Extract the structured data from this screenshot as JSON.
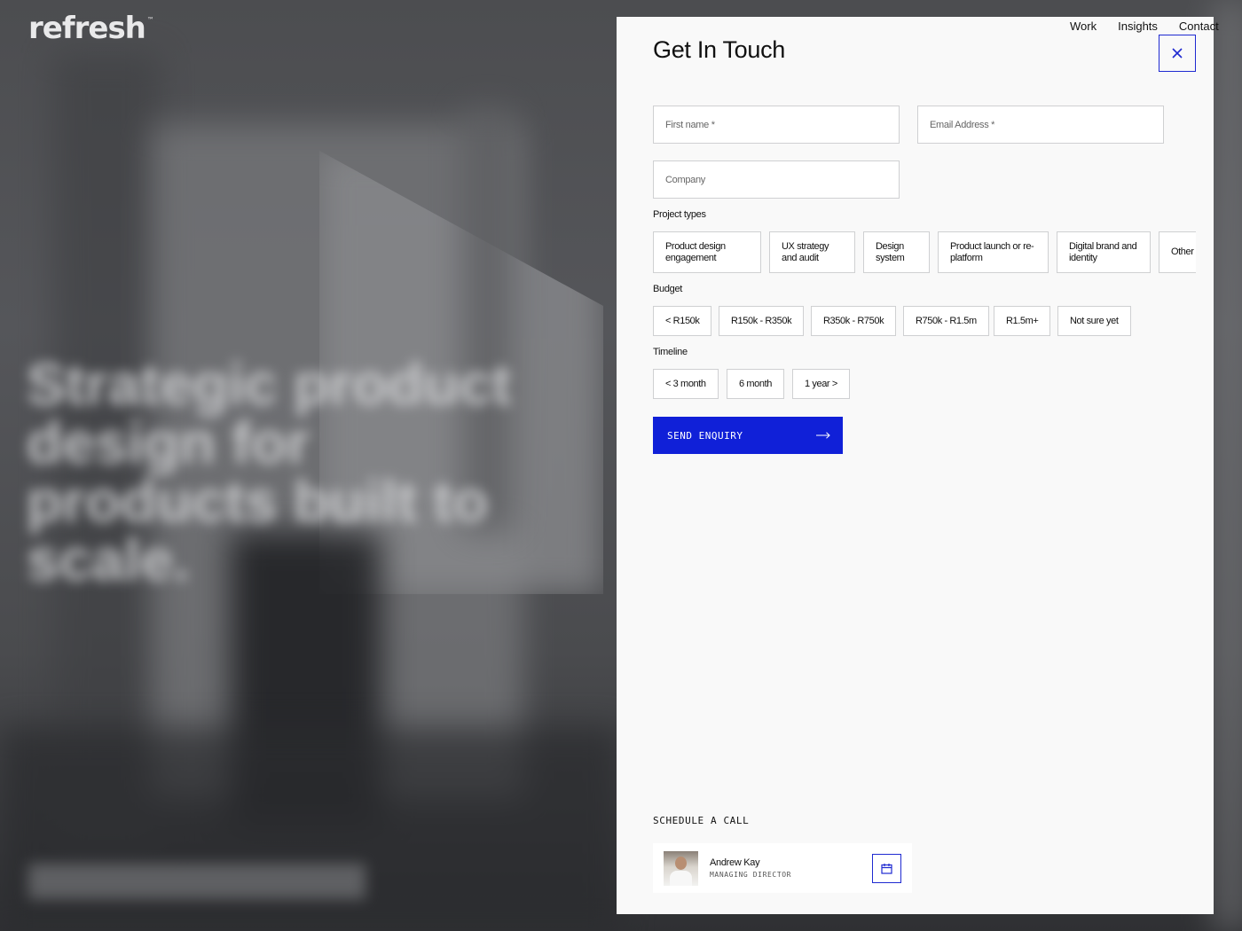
{
  "brand": {
    "logo": "refresh",
    "trademark": "™"
  },
  "nav": {
    "items": [
      "Work",
      "Insights",
      "Contact"
    ]
  },
  "hero": {
    "title": "Strategic product design for products built to scale."
  },
  "panel": {
    "title": "Get In Touch",
    "close_icon": "close-icon",
    "fields": {
      "first_name": {
        "placeholder": "First name *",
        "value": ""
      },
      "email": {
        "placeholder": "Email Address *",
        "value": ""
      },
      "company": {
        "placeholder": "Company",
        "value": ""
      }
    },
    "project_types": {
      "label": "Project types",
      "options": [
        "Product design engagement",
        "UX strategy and audit",
        "Design system",
        "Product launch or re-platform",
        "Digital brand and identity",
        "Other"
      ]
    },
    "budget": {
      "label": "Budget",
      "options": [
        "< R150k",
        "R150k - R350k",
        "R350k - R750k",
        "R750k - R1.5m",
        "R1.5m+",
        "Not sure yet"
      ]
    },
    "timeline": {
      "label": "Timeline",
      "options": [
        "< 3 month",
        "6 month",
        "1 year >"
      ]
    },
    "send_button": {
      "label": "SEND ENQUIRY",
      "icon": "arrow-right-icon"
    },
    "schedule": {
      "label": "SCHEDULE A CALL",
      "contact": {
        "name": "Andrew Kay",
        "role": "MANAGING DIRECTOR",
        "icon": "calendar-icon"
      }
    },
    "colors": {
      "accent": "#1020d8",
      "panel_bg": "#f9f9f9",
      "border": "#cfd0d2"
    }
  }
}
